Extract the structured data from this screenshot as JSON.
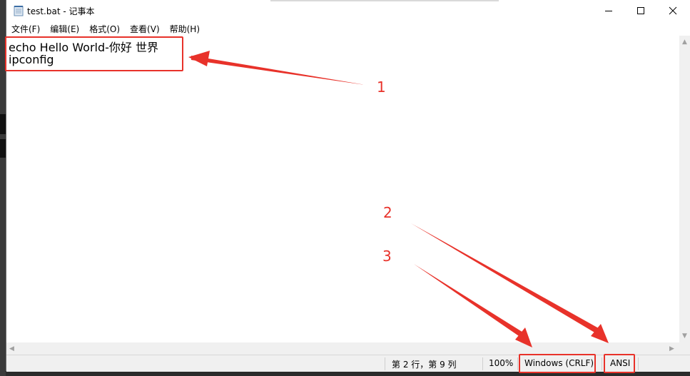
{
  "window": {
    "title": "test.bat - 记事本",
    "app_icon": "notepad-icon",
    "controls": [
      "minimize-icon",
      "maximize-icon",
      "close-icon"
    ]
  },
  "menu": {
    "items": [
      "文件(F)",
      "编辑(E)",
      "格式(O)",
      "查看(V)",
      "帮助(H)"
    ]
  },
  "editor": {
    "lines": [
      "echo Hello World-你好 世界",
      "ipconfig"
    ]
  },
  "status": {
    "position": "第 2 行，第 9 列",
    "zoom": "100%",
    "line_ending": "Windows (CRLF)",
    "encoding": "ANSI"
  },
  "annotations": {
    "labels": [
      "1",
      "2",
      "3"
    ],
    "color": "#e8322a"
  }
}
